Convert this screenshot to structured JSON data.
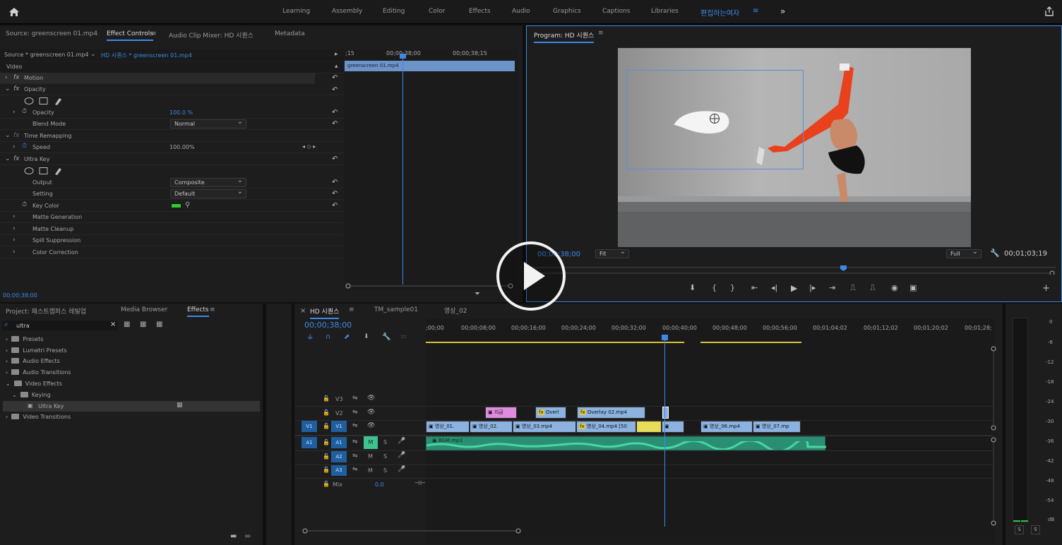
{
  "topbar": {
    "workspaces": [
      "Learning",
      "Assembly",
      "Editing",
      "Color",
      "Effects",
      "Audio",
      "Graphics",
      "Captions",
      "Libraries",
      "편집하는여자",
      "≡",
      "»"
    ]
  },
  "effect_controls": {
    "tabs": [
      "Source: greenscreen 01.mp4",
      "Effect Controls",
      "≡",
      "Audio Clip Mixer: HD 시퀀스",
      "Metadata"
    ],
    "source_label": "Source * greenscreen 01.mp4",
    "seq_label": "HD 시퀀스 * greenscreen 01.mp4",
    "video_header": "Video",
    "rows": {
      "motion": "Motion",
      "opacity": "Opacity",
      "opacity_prop": "Opacity",
      "opacity_val": "100.0 %",
      "blend": "Blend Mode",
      "blend_val": "Normal",
      "time_remap": "Time Remapping",
      "speed": "Speed",
      "speed_val": "100.00%",
      "ultra": "Ultra Key",
      "output": "Output",
      "output_val": "Composite",
      "setting": "Setting",
      "setting_val": "Default",
      "keycolor": "Key Color",
      "matte_gen": "Matte Generation",
      "matte_clean": "Matte Cleanup",
      "spill": "Spill Suppression",
      "colorcorr": "Color Correction"
    },
    "time_ticks": [
      ";15",
      "00;00;38;00",
      "00;00;38;15"
    ],
    "clip_label": "greenscreen 01.mp4",
    "timecode": "00;00;38;00",
    "key_color": "#2ecc2e"
  },
  "program": {
    "title": "Program: HD 시퀀스",
    "menu": "≡",
    "timecode": "00;00;38;00",
    "fit": "Fit",
    "quality": "Full",
    "duration": "00;01;03;19"
  },
  "project": {
    "tabs": [
      "Project: 패스트캠퍼스 레빌업",
      "Media Browser",
      "Effects",
      "≡"
    ],
    "search": "ultra",
    "tree": [
      "Presets",
      "Lumetri Presets",
      "Audio Effects",
      "Audio Transitions",
      "Video Effects",
      "Keying",
      "Ultra Key",
      "Video Transitions"
    ]
  },
  "timeline": {
    "tabs": [
      "HD 시퀀스",
      "≡",
      "TM_sample01",
      "영상_02"
    ],
    "close": "×",
    "timecode": "00;00;38;00",
    "ruler": [
      ";00;00",
      "00;00;08;00",
      "00;00;16;00",
      "00;00;24;00",
      "00;00;32;00",
      "00;00;40;00",
      "00;00;48;00",
      "00;00;56;00",
      "00;01;04;02",
      "00;01;12;02",
      "00;01;20;02",
      "00;01;28;"
    ],
    "tracks": {
      "v3": "V3",
      "v2": "V2",
      "v1": "V1",
      "a1": "A1",
      "a2": "A2",
      "a3": "A3",
      "mix": "Mix",
      "mix_val": "0.0",
      "m": "M",
      "s": "S"
    },
    "clips_v2": [
      "지금",
      "Overl",
      "Overlay 02.mp4"
    ],
    "clips_v1": [
      "영상_01.",
      "영상_02.",
      "영상_03.mp4",
      "영상_04.mp4 [50",
      "영상_06.mp4",
      "영상_07.mp"
    ],
    "clip_a1": "BGM.mp3"
  },
  "meter": {
    "scale": [
      "0",
      "-6",
      "-12",
      "-18",
      "-24",
      "-30",
      "-36",
      "-42",
      "-48",
      "-54",
      "dB"
    ],
    "solo": [
      "S",
      "S"
    ]
  }
}
